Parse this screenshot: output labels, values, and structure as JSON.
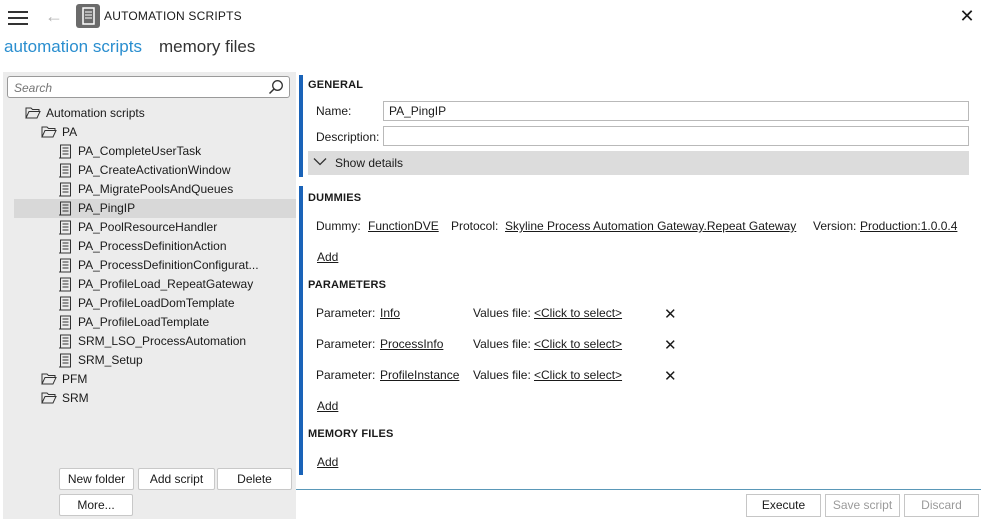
{
  "header": {
    "title": "AUTOMATION SCRIPTS"
  },
  "tabs": [
    {
      "label": "automation scripts",
      "active": true
    },
    {
      "label": "memory files",
      "active": false
    }
  ],
  "sidebar": {
    "search_placeholder": "Search",
    "tree": {
      "root": "Automation scripts",
      "folders": [
        {
          "label": "PA",
          "items": [
            "PA_CompleteUserTask",
            "PA_CreateActivationWindow",
            "PA_MigratePoolsAndQueues",
            "PA_PingIP",
            "PA_PoolResourceHandler",
            "PA_ProcessDefinitionAction",
            "PA_ProcessDefinitionConfigurat...",
            "PA_ProfileLoad_RepeatGateway",
            "PA_ProfileLoadDomTemplate",
            "PA_ProfileLoadTemplate",
            "SRM_LSO_ProcessAutomation",
            "SRM_Setup"
          ],
          "selected": "PA_PingIP"
        },
        {
          "label": "PFM"
        },
        {
          "label": "SRM"
        }
      ]
    },
    "buttons": {
      "new_folder": "New folder",
      "add_script": "Add script",
      "delete": "Delete",
      "more": "More..."
    }
  },
  "general": {
    "title": "GENERAL",
    "name_label": "Name:",
    "name_value": "PA_PingIP",
    "description_label": "Description:",
    "description_value": "",
    "show_details": "Show details"
  },
  "dummies": {
    "title": "DUMMIES",
    "dummy_label": "Dummy:",
    "dummy_value": "FunctionDVE",
    "protocol_label": "Protocol:",
    "protocol_value": "Skyline Process Automation Gateway.Repeat Gateway",
    "version_label": "Version:",
    "version_value": "Production:1.0.0.4",
    "add": "Add"
  },
  "parameters": {
    "title": "PARAMETERS",
    "rows": [
      {
        "label": "Parameter:",
        "name": "Info",
        "values_label": "Values file:",
        "values_value": "<Click to select>"
      },
      {
        "label": "Parameter:",
        "name": "ProcessInfo",
        "values_label": "Values file:",
        "values_value": "<Click to select>"
      },
      {
        "label": "Parameter:",
        "name": "ProfileInstance",
        "values_label": "Values file:",
        "values_value": "<Click to select>"
      }
    ],
    "add": "Add"
  },
  "memory_files": {
    "title": "MEMORY FILES",
    "add": "Add"
  },
  "footer": {
    "execute": "Execute",
    "save": "Save script",
    "discard": "Discard"
  },
  "colors": {
    "accent": "#2a8ecf",
    "section_bar": "#1a63b8"
  }
}
